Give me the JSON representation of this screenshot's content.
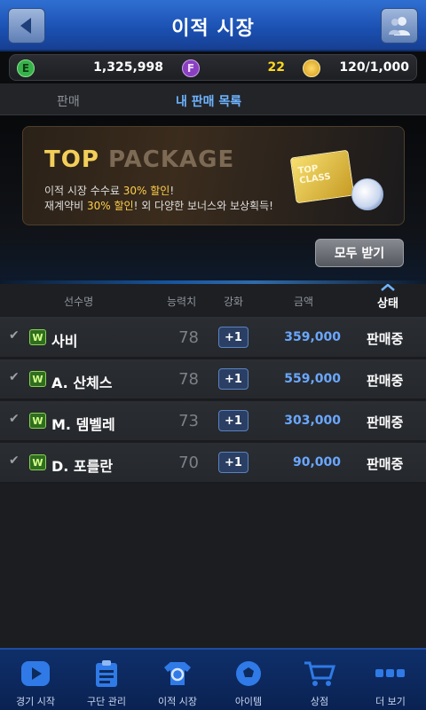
{
  "header": {
    "title": "이적 시장",
    "back_icon": "back-arrow-icon",
    "friends_icon": "friends-icon"
  },
  "currency": {
    "e_symbol": "E",
    "e_value": "1,325,998",
    "f_symbol": "F",
    "f_value": "22",
    "gold_value": "120/1,000"
  },
  "tabs": [
    {
      "label": "판매"
    },
    {
      "label": "내 판매 목록"
    }
  ],
  "banner": {
    "title_top": "TOP",
    "title_package": "PACKAGE",
    "line1_pre": "이적 시장 수수료 ",
    "line1_hl": "30% 할인",
    "line1_post": "!",
    "line2_pre": "재계약비 ",
    "line2_hl": "30% 할인",
    "line2_post": "! 외 다양한 보너스와 보상획득!",
    "ticket_line1": "TOP",
    "ticket_line2": "CLASS"
  },
  "receive_all_label": "모두 받기",
  "table": {
    "headers": {
      "name": "선수명",
      "ability": "능력치",
      "enhance": "강화",
      "price": "금액",
      "status": "상태"
    },
    "rows": [
      {
        "badge": "W",
        "name": "사비",
        "ability": "78",
        "enhance": "+1",
        "price": "359,000",
        "status": "판매중"
      },
      {
        "badge": "W",
        "name": "A. 산체스",
        "ability": "78",
        "enhance": "+1",
        "price": "559,000",
        "status": "판매중"
      },
      {
        "badge": "W",
        "name": "M. 뎀벨레",
        "ability": "73",
        "enhance": "+1",
        "price": "303,000",
        "status": "판매중"
      },
      {
        "badge": "W",
        "name": "D. 포를란",
        "ability": "70",
        "enhance": "+1",
        "price": "90,000",
        "status": "판매중"
      }
    ]
  },
  "bottom_nav": [
    {
      "label": "경기 시작",
      "icon": "play-icon"
    },
    {
      "label": "구단 관리",
      "icon": "clipboard-icon"
    },
    {
      "label": "이적 시장",
      "icon": "transfer-shirt-icon"
    },
    {
      "label": "아이템",
      "icon": "ball-icon"
    },
    {
      "label": "상점",
      "icon": "cart-icon"
    },
    {
      "label": "더 보기",
      "icon": "more-icon"
    }
  ],
  "colors": {
    "accent": "#6fb4ff",
    "price": "#6aa7ff",
    "header": "#1a4fb0",
    "highlight": "#ffcf4a"
  }
}
